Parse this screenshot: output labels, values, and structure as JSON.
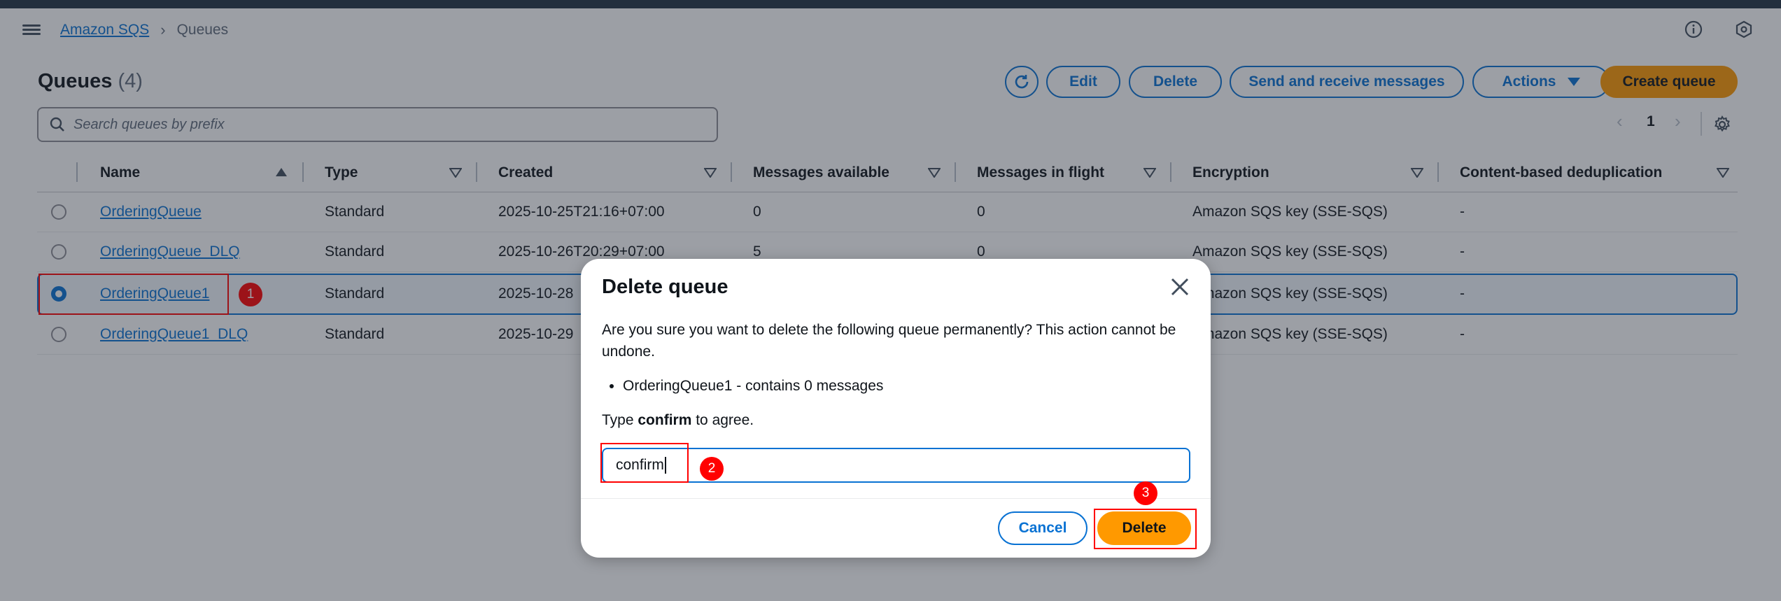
{
  "breadcrumb": {
    "service": "Amazon SQS",
    "current": "Queues"
  },
  "page": {
    "title": "Queues",
    "count": "(4)"
  },
  "toolbar": {
    "edit": "Edit",
    "delete": "Delete",
    "send_receive": "Send and receive messages",
    "actions": "Actions",
    "create": "Create queue"
  },
  "search": {
    "placeholder": "Search queues by prefix"
  },
  "pagination": {
    "page": "1"
  },
  "table": {
    "headers": [
      "Name",
      "Type",
      "Created",
      "Messages available",
      "Messages in flight",
      "Encryption",
      "Content-based deduplication"
    ],
    "rows": [
      {
        "name": "OrderingQueue",
        "type": "Standard",
        "created": "2025-10-25T21:16+07:00",
        "available": "0",
        "in_flight": "0",
        "encryption": "Amazon SQS key (SSE-SQS)",
        "dedup": "-",
        "selected": false
      },
      {
        "name": "OrderingQueue_DLQ",
        "type": "Standard",
        "created": "2025-10-26T20:29+07:00",
        "available": "5",
        "in_flight": "0",
        "encryption": "Amazon SQS key (SSE-SQS)",
        "dedup": "-",
        "selected": false
      },
      {
        "name": "OrderingQueue1",
        "type": "Standard",
        "created": "2025-10-28",
        "available": "",
        "in_flight": "",
        "encryption": "Amazon SQS key (SSE-SQS)",
        "dedup": "-",
        "selected": true
      },
      {
        "name": "OrderingQueue1_DLQ",
        "type": "Standard",
        "created": "2025-10-29",
        "available": "",
        "in_flight": "",
        "encryption": "Amazon SQS key (SSE-SQS)",
        "dedup": "-",
        "selected": false
      }
    ]
  },
  "modal": {
    "title": "Delete queue",
    "message": "Are you sure you want to delete the following queue permanently? This action cannot be undone.",
    "item": "OrderingQueue1 - contains 0 messages",
    "type_prefix": "Type ",
    "type_word": "confirm",
    "type_suffix": " to agree.",
    "input_value": "confirm",
    "cancel": "Cancel",
    "delete": "Delete"
  },
  "annotations": {
    "one": "1",
    "two": "2",
    "three": "3"
  },
  "colors": {
    "accent": "#0972d3",
    "primary_button": "#ff9900",
    "annotation": "#ff0000"
  }
}
